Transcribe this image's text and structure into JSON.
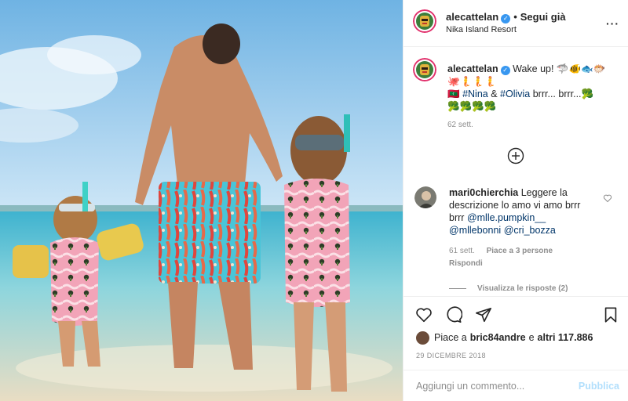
{
  "header": {
    "username": "alecattelan",
    "follow_label": "Segui già",
    "location": "Nika Island Resort"
  },
  "caption": {
    "username": "alecattelan",
    "text_1": "Wake up! 🦈🐠🐟🐡",
    "text_2": "🐙🧜🧜🧜",
    "tag_1": "#Nina",
    "amp": " & ",
    "tag_2": "#Olivia",
    "text_3": " brrr... brrr...🥦",
    "text_4": "🥦🥦🥦🥦",
    "flag": "🇲🇻",
    "time": "62 sett."
  },
  "comment": {
    "username": "mari0chierchia",
    "text": "Leggere la descrizione lo amo vi amo brrr brrr",
    "mention_1": "@mlle.pumpkin__",
    "mention_2": "@mllebonni",
    "mention_3": "@cri_bozza",
    "time": "61 sett.",
    "likes_label": "Piace a 3 persone",
    "reply_label": "Rispondi",
    "view_replies_label": "Visualizza le risposte (2)"
  },
  "likes": {
    "prefix": "Piace a",
    "user": "bric84andre",
    "conj": "e",
    "others": "altri 117.886"
  },
  "date": "29 DICEMBRE 2018",
  "add_comment": {
    "placeholder": "Aggiungi un commento...",
    "publish_label": "Pubblica"
  },
  "icons": {
    "more": "more-icon",
    "load_more": "plus-circle-icon",
    "like": "heart-icon",
    "comment": "comment-bubble-icon",
    "share": "paper-plane-icon",
    "save": "bookmark-icon",
    "verified": "verified-badge-icon"
  },
  "colors": {
    "link": "#003569",
    "verified": "#3897f0",
    "secondary_text": "#8e8e8e",
    "publish_disabled": "#b2dffc"
  }
}
